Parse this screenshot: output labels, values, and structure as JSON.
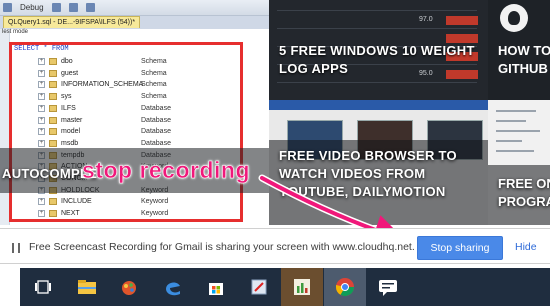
{
  "ide": {
    "toolbar_debug": "Debug",
    "query_tab": "QLQuery1.sql - DE...-9IFSPA\\ILFS (54))*",
    "mode_label": "lest mode",
    "query_text_select": "SELECT",
    "query_text_from": "* FROM",
    "tree_rows": [
      {
        "name": "dbo",
        "type": "Schema"
      },
      {
        "name": "guest",
        "type": "Schema"
      },
      {
        "name": "INFORMATION_SCHEMA",
        "type": "Schema"
      },
      {
        "name": "sys",
        "type": "Schema"
      },
      {
        "name": "ILFS",
        "type": "Database"
      },
      {
        "name": "master",
        "type": "Database"
      },
      {
        "name": "model",
        "type": "Database"
      },
      {
        "name": "msdb",
        "type": "Database"
      },
      {
        "name": "tempdb",
        "type": "Database"
      },
      {
        "name": "ACTION",
        "type": "Keyword"
      },
      {
        "name": "CONC...",
        "type": ""
      },
      {
        "name": "HOLDLOCK",
        "type": "Keyword"
      },
      {
        "name": "INCLUDE",
        "type": "Keyword"
      },
      {
        "name": "NEXT",
        "type": "Keyword"
      }
    ]
  },
  "tiles": {
    "left_title": "AUTOCOMPLE",
    "mid_title": "5 FREE WINDOWS 10 WEIGHT LOG APPS",
    "mid_title_2": "FREE VIDEO BROWSER TO WATCH VIDEOS FROM YOUTUBE, DAILYMOTION",
    "right_title_1": "HOW TO",
    "right_title_1b": "GITHUB",
    "right_title_2": "FREE ONI",
    "right_title_2b": "PROGRA"
  },
  "annotation": {
    "text": "stop recording",
    "color": "#f0187a"
  },
  "share_bar": {
    "message": "Free Screencast Recording for Gmail is sharing your screen with www.cloudhq.net.",
    "stop_label": "Stop sharing",
    "hide_label": "Hide"
  },
  "taskbar": {
    "icons": [
      "task-view-icon",
      "file-explorer-icon",
      "paint-icon",
      "edge-icon",
      "store-icon",
      "snipping-icon",
      "chart-app-icon",
      "chrome-icon",
      "message-icon"
    ]
  }
}
